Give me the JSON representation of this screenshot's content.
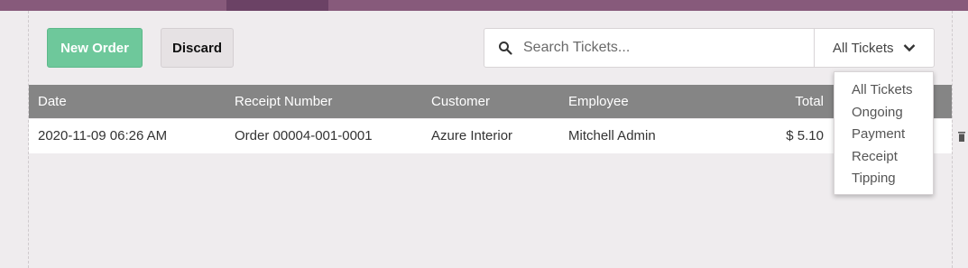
{
  "toolbar": {
    "new_order_label": "New Order",
    "discard_label": "Discard"
  },
  "search": {
    "placeholder": "Search Tickets..."
  },
  "filter": {
    "selected": "All Tickets",
    "options": [
      "All Tickets",
      "Ongoing",
      "Payment",
      "Receipt",
      "Tipping"
    ]
  },
  "table": {
    "headers": [
      "Date",
      "Receipt Number",
      "Customer",
      "Employee",
      "Total"
    ],
    "rows": [
      {
        "date": "2020-11-09 06:26 AM",
        "receipt": "Order 00004-001-0001",
        "customer": "Azure Interior",
        "employee": "Mitchell Admin",
        "total": "$ 5.10"
      }
    ]
  },
  "colors": {
    "brand": "#875a7b",
    "accent_green": "#6ec89b",
    "header_gray": "#858585",
    "background": "#efecee"
  }
}
